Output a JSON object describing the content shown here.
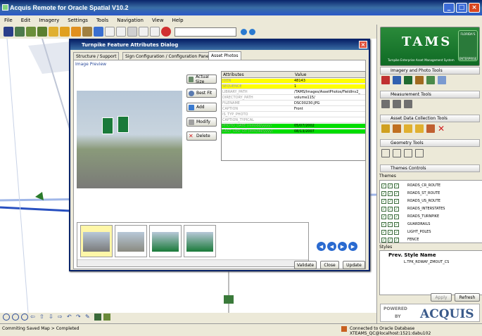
{
  "app": {
    "title": "Acquis Remote for Oracle Spatial V10.2"
  },
  "menu": [
    "File",
    "Edit",
    "Imagery",
    "Settings",
    "Tools",
    "Navigation",
    "View",
    "Help"
  ],
  "dialog": {
    "title": "Turnpike Feature Attributes Dialog",
    "tabs": [
      "Structure / Support",
      "Sign Configuration / Configuration Panels",
      "Asset Photos"
    ],
    "image_preview_label": "Image Preview",
    "buttons": {
      "actual_size": "Actual Size",
      "best_fit": "Best Fit",
      "add": "Add",
      "modify": "Modify",
      "delete": "Delete"
    },
    "table": {
      "headers": [
        "Attributes",
        "Value"
      ],
      "rows": [
        {
          "attr": "IDEN",
          "value": "48143",
          "color": "#ffff00"
        },
        {
          "attr": "SEQUENCE",
          "value": "1",
          "color": "#ffff00"
        },
        {
          "attr": "LIBRARY_PATH",
          "value": "/TAMS/Images/AssetPhotos/FieldInv2_",
          "color": "#ffffff"
        },
        {
          "attr": "DIRECTORY_PATH",
          "value": "volume115/",
          "color": "#ffffff"
        },
        {
          "attr": "FILENAME",
          "value": "DSC00230.JPG",
          "color": "#ffffff"
        },
        {
          "attr": "CAPTION",
          "value": "Front",
          "color": "#ffffff"
        },
        {
          "attr": "IS_TYP_PHOTO",
          "value": "",
          "color": "#ffffff"
        },
        {
          "attr": "CAPTION_TYPICAL",
          "value": "",
          "color": "#ffffff"
        },
        {
          "attr": "PHOTO_DATE (mm/dd/yyyy)",
          "value": "05/07/2002",
          "color": "#00dd00"
        },
        {
          "attr": "LAST_UPD_DT (mm/dd/yyyy)",
          "value": "08/13/2007",
          "color": "#00dd00"
        }
      ]
    },
    "footer_buttons": {
      "validate": "Validate",
      "close": "Close",
      "update": "Update"
    }
  },
  "right_panel": {
    "logo_text": "TAMS",
    "logo_subtitle": "Turnpike Enterprise Asset Management System",
    "logo_badge_top": "FLORIDA'S",
    "logo_badge_bottom": "ENTERPRISE",
    "sections": {
      "imagery": "Imagery and Photo Tools",
      "measurement": "Measurement Tools",
      "asset": "Asset Data Collection Tools",
      "geometry": "Geometry Tools",
      "themes": "Themes Controls"
    },
    "themes_label": "Themes",
    "themes": [
      "ROADS_CR_ROUTE",
      "ROADS_ST_ROUTE",
      "ROADS_US_ROUTE",
      "ROADS_INTERSTATES",
      "ROADS_TURNPIKE",
      "GUARDRAILS",
      "LIGHT_POLES",
      "FENCE"
    ],
    "styles_label": "Styles",
    "styles_header": "Prev.  Style Name",
    "style_row": "L.TPK_RDWAY_ZMOUT_CS",
    "apply": "Apply",
    "refresh": "Refresh",
    "powered_by_1": "POWERED",
    "powered_by_2": "BY",
    "brand": "ACQUIS"
  },
  "status": {
    "left": "Commiting Saved Map > Completed",
    "right": "Connected to Oracle Database XTEAMS_QC@localhost:1521:dabu102"
  }
}
